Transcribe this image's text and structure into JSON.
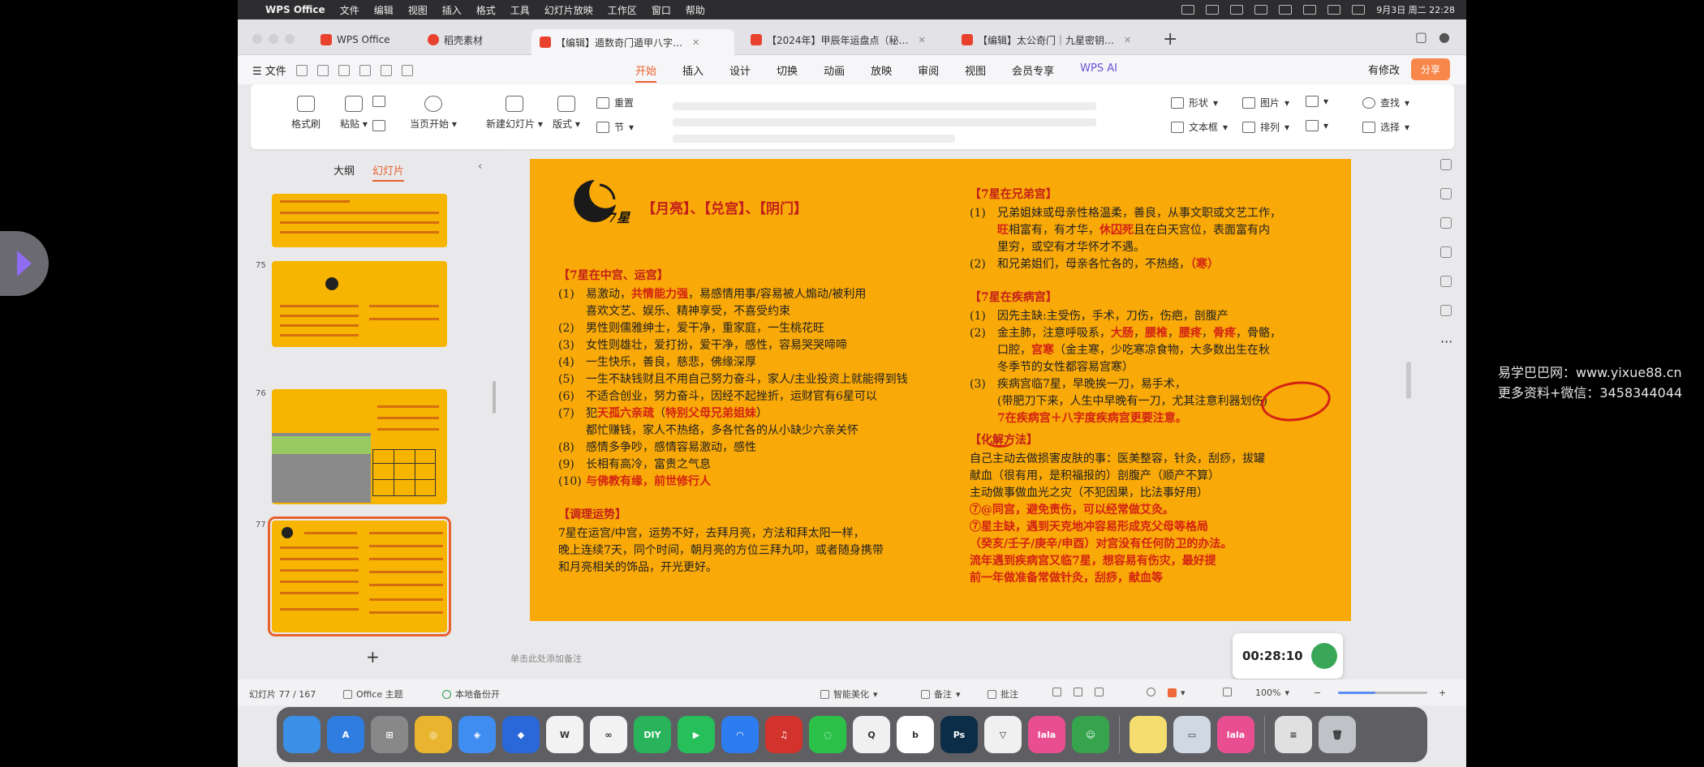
{
  "menubar": {
    "app": "WPS Office",
    "items": [
      "文件",
      "编辑",
      "视图",
      "插入",
      "格式",
      "工具",
      "幻灯片放映",
      "工作区",
      "窗口",
      "帮助"
    ],
    "datetime": "9月3日 周二  22:28"
  },
  "tabs": [
    {
      "label": "WPS Office",
      "color": "#e8412d"
    },
    {
      "label": "稻壳素材",
      "color": "#e8412d"
    },
    {
      "label": "【编辑】遁数奇门遁甲八字…",
      "color": "#e8412d"
    },
    {
      "label": "【2024年】甲辰年运盘点（秘…",
      "color": "#e8412d"
    },
    {
      "label": "【编辑】太公奇门｜九星密钥…",
      "color": "#e8412d"
    }
  ],
  "ribbon_tabs": {
    "file": "文件",
    "tabs": [
      "开始",
      "插入",
      "设计",
      "切换",
      "动画",
      "放映",
      "审阅",
      "视图",
      "会员专享",
      "WPS AI"
    ],
    "active": "开始",
    "modify": "有修改",
    "share": "分享"
  },
  "ribbon": {
    "format_painter": "格式刷",
    "paste": "粘贴",
    "from_start": "当页开始",
    "new_slide": "新建幻灯片",
    "layout": "版式",
    "reset": "重置",
    "section": "节",
    "shape": "形状",
    "picture": "图片",
    "textbox": "文本框",
    "arrange": "排列",
    "find": "查找",
    "select": "选择"
  },
  "panel": {
    "tab_outline": "大纲",
    "tab_slides": "幻灯片",
    "thumb_numbers": [
      "75",
      "76",
      "77"
    ]
  },
  "slide": {
    "logo_text": "7星",
    "title": "【月亮】、【兑宫】、【阴门】",
    "left": {
      "sec1": "【7星在中宫、运宫】",
      "items": [
        {
          "n": "(1)",
          "parts": [
            [
              "易激动，",
              ""
            ],
            [
              "共情能力强",
              "red"
            ],
            [
              "，易感情用事/容易被人煽动/被利用",
              ""
            ]
          ]
        },
        {
          "n": "",
          "parts": [
            [
              "喜欢文艺、娱乐、精神享受，不喜受约束",
              ""
            ]
          ]
        },
        {
          "n": "(2)",
          "parts": [
            [
              "男性则儒雅绅士，爱干净，重家庭，一生桃花旺",
              ""
            ]
          ]
        },
        {
          "n": "(3)",
          "parts": [
            [
              "女性则雄壮，爱打扮，爱干净，感性，容易哭哭啼啼",
              ""
            ]
          ]
        },
        {
          "n": "(4)",
          "parts": [
            [
              "一生快乐，善良，慈悲，佛缘深厚",
              ""
            ]
          ]
        },
        {
          "n": "(5)",
          "parts": [
            [
              "一生不缺钱财且不用自己努力奋斗，家人/主业投资上就能得到钱",
              ""
            ]
          ]
        },
        {
          "n": "(6)",
          "parts": [
            [
              "不适合创业，努力奋斗，因经不起挫折，运财官有6星可以",
              ""
            ]
          ]
        },
        {
          "n": "(7)",
          "parts": [
            [
              "犯",
              ""
            ],
            [
              "天孤六亲疏",
              "red"
            ],
            [
              "（",
              ""
            ],
            [
              "特别父母兄弟姐妹",
              "red"
            ],
            [
              "）",
              ""
            ]
          ]
        },
        {
          "n": "",
          "parts": [
            [
              "都忙赚钱，家人不热络，多各忙各的从小缺少六亲关怀",
              ""
            ]
          ]
        },
        {
          "n": "(8)",
          "parts": [
            [
              "感情多争吵，感情容易激动，感性",
              ""
            ]
          ]
        },
        {
          "n": "(9)",
          "parts": [
            [
              "长相有高冷，富贵之气息",
              ""
            ]
          ]
        },
        {
          "n": "(10)",
          "parts": [
            [
              "与佛教有缘，前世修行人",
              "red"
            ]
          ]
        }
      ],
      "sec2": "【调理运势】",
      "adjust": [
        "7星在运宫/中宫，运势不好，去拜月亮，方法和拜太阳一样，",
        "晚上连续7天，同个时间，朝月亮的方位三拜九叩，或者随身携带",
        "和月亮相关的饰品，开光更好。"
      ]
    },
    "right": {
      "sec1": "【7星在兄弟宫】",
      "brother": [
        {
          "n": "(1)",
          "parts": [
            [
              "兄弟姐妹或母亲性格温柔，善良，从事文职或文艺工作，",
              ""
            ]
          ]
        },
        {
          "n": "",
          "parts": [
            [
              "旺",
              "red"
            ],
            [
              "相富有，有才华，",
              ""
            ],
            [
              "休囚死",
              "red"
            ],
            [
              "且在白天宫位，表面富有内",
              ""
            ]
          ]
        },
        {
          "n": "",
          "parts": [
            [
              "里穷，或空有才华怀才不遇。",
              ""
            ]
          ]
        },
        {
          "n": "(2)",
          "parts": [
            [
              "和兄弟姐们，母亲各忙各的，不热络，",
              ""
            ],
            [
              "（寒）",
              "red"
            ]
          ]
        }
      ],
      "sec2": "【7星在疾病宫】",
      "illness": [
        {
          "n": "(1)",
          "parts": [
            [
              "因先主缺:主受伤，手术，刀伤，伤疤，剖腹产",
              ""
            ]
          ]
        },
        {
          "n": "(2)",
          "parts": [
            [
              "金主肺，注意呼吸系，",
              ""
            ],
            [
              "大肠",
              "red"
            ],
            [
              "，",
              ""
            ],
            [
              "腰椎",
              "red"
            ],
            [
              "，",
              ""
            ],
            [
              "腰疼",
              "red"
            ],
            [
              "，",
              ""
            ],
            [
              "骨疼",
              "red"
            ],
            [
              "，骨骼，",
              ""
            ]
          ]
        },
        {
          "n": "",
          "parts": [
            [
              "口腔，",
              ""
            ],
            [
              "宫寒",
              "red"
            ],
            [
              "（金主寒，少吃寒凉食物，大多数出生在秋",
              ""
            ]
          ]
        },
        {
          "n": "",
          "parts": [
            [
              "冬季节的女性都容易宫寒）",
              ""
            ]
          ]
        },
        {
          "n": "(3)",
          "parts": [
            [
              "疾病宫临7星，早晚挨一刀，易手术，",
              ""
            ]
          ]
        },
        {
          "n": "",
          "parts": [
            [
              "(带肥刀下来，人生中早晚有一刀，尤其注意利器划伤)",
              ""
            ]
          ]
        },
        {
          "n": "",
          "parts": [
            [
              "7在疾病宫＋八字度疾病宫更要注意。",
              "red"
            ]
          ]
        }
      ],
      "sec3": "【化解方法】",
      "resolve": [
        [
          [
            "自己主动去做损害皮肤的事：医美整容，针灸，刮痧，拔罐",
            ""
          ]
        ],
        [
          [
            "献血（很有用，是积福报的）剖腹产（顺产不算）",
            ""
          ]
        ],
        [
          [
            "主动做事做血光之灾（不犯因果，比法事好用）",
            ""
          ]
        ],
        [
          [
            "⑦@同宫，避免责伤，可以经常做艾灸。",
            "red"
          ]
        ],
        [
          [
            "⑦星主缺，遇到天克地冲容易形成克父母等格局",
            "red"
          ]
        ],
        [
          [
            "（癸亥/壬子/庚辛/申酉）对宫没有任何防卫的办法。",
            "red"
          ]
        ],
        [
          [
            "流年遇到疾病宫又临7星，想容易有伤灾，最好提",
            "red"
          ]
        ],
        [
          [
            "前一年做准备常做针灸，刮痧，献血等",
            "red"
          ]
        ]
      ]
    }
  },
  "notes_placeholder": "单击此处添加备注",
  "timer": "00:28:10",
  "status": {
    "slide_pos": "幻灯片 77 / 167",
    "theme": "Office 主题",
    "backup": "本地备份开",
    "beautify": "智能美化",
    "notes": "备注",
    "comment": "批注",
    "zoom": "100%",
    "zoom_level": 0.42
  },
  "dock": [
    {
      "name": "finder",
      "color": "#3b8fe6",
      "g": ""
    },
    {
      "name": "app-store",
      "color": "#2f7de1",
      "g": "A"
    },
    {
      "name": "launchpad",
      "color": "#888",
      "g": "⊞"
    },
    {
      "name": "chrome",
      "color": "#e9b52f",
      "g": "◎"
    },
    {
      "name": "safari",
      "color": "#3f8df0",
      "g": "◈"
    },
    {
      "name": "feishu",
      "color": "#2a67d8",
      "g": "◆"
    },
    {
      "name": "wps",
      "color": "#f2f2f2",
      "g": "W"
    },
    {
      "name": "baidu-netdisk",
      "color": "#f2f2f2",
      "g": "∞"
    },
    {
      "name": "diyi",
      "color": "#29b35b",
      "g": "DIY"
    },
    {
      "name": "iqiyi-video",
      "color": "#26bf5a",
      "g": "▶"
    },
    {
      "name": "tencent-meeting",
      "color": "#2d7cf0",
      "g": "◠"
    },
    {
      "name": "netease-music",
      "color": "#d2342d",
      "g": "♫"
    },
    {
      "name": "wechat",
      "color": "#2cc24a",
      "g": "◌"
    },
    {
      "name": "qq",
      "color": "#f0f0f0",
      "g": "Q"
    },
    {
      "name": "bing",
      "color": "#ffffff",
      "g": "b"
    },
    {
      "name": "photoshop",
      "color": "#0c2d48",
      "g": "Ps"
    },
    {
      "name": "triangle-app",
      "color": "#f0f0f0",
      "g": "▽"
    },
    {
      "name": "lala-app",
      "color": "#e94e91",
      "g": "lala"
    },
    {
      "name": "green-mascot",
      "color": "#35a44c",
      "g": "☺"
    },
    {
      "name": "notes",
      "color": "#f6dd6f",
      "g": ""
    },
    {
      "name": "preview",
      "color": "#cfd8e3",
      "g": "▭"
    },
    {
      "name": "lala-app-2",
      "color": "#e94e91",
      "g": "lala"
    },
    {
      "name": "document-viewer",
      "color": "#e0e0e0",
      "g": "≡"
    },
    {
      "name": "trash",
      "color": "#bfc3c8",
      "g": "🗑"
    }
  ],
  "watermark": {
    "line1": "易学巴巴网：www.yixue88.cn",
    "line2": "更多资料+微信：3458344044"
  },
  "colors": {
    "accent": "#e8602c",
    "slide_bg": "#f9a908",
    "slide_red": "#c31f1a"
  }
}
